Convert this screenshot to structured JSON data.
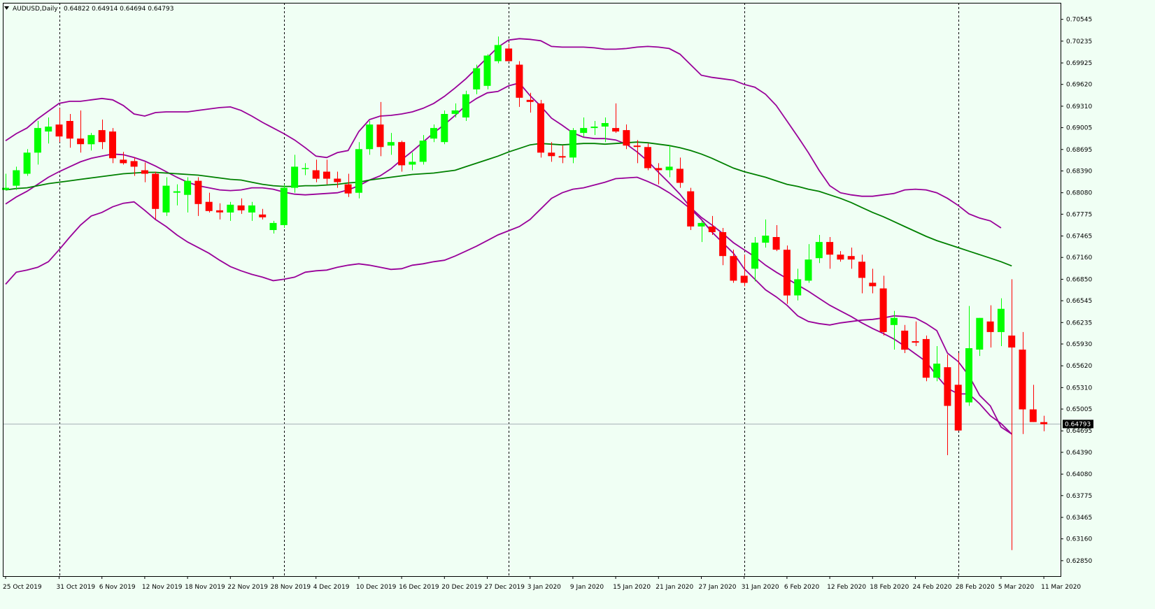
{
  "window": {
    "title": "AUDUSD,Daily",
    "ohlc": "0.64822 0.64914 0.64694 0.64793"
  },
  "colors": {
    "background": "#F0FFF4",
    "bull": "#00FF00",
    "bear": "#FF0000",
    "bands": "#990099",
    "ma": "#008000",
    "grid": "#000000"
  },
  "chart_data": {
    "type": "candlestick",
    "symbol": "AUDUSD",
    "timeframe": "Daily",
    "current_price": "0.64793",
    "ylim": [
      0.6263,
      0.7078
    ],
    "y_ticks": [
      "0.70545",
      "0.70235",
      "0.69925",
      "0.69620",
      "0.69310",
      "0.69005",
      "0.68695",
      "0.68390",
      "0.68080",
      "0.67775",
      "0.67465",
      "0.67160",
      "0.66850",
      "0.66545",
      "0.66235",
      "0.65930",
      "0.65620",
      "0.65310",
      "0.65005",
      "0.64695",
      "0.64390",
      "0.64080",
      "0.63775",
      "0.63465",
      "0.63160",
      "0.62850"
    ],
    "x_ticks": [
      {
        "label": "25 Oct 2019",
        "i": 0
      },
      {
        "label": "31 Oct 2019",
        "i": 5
      },
      {
        "label": "6 Nov 2019",
        "i": 9
      },
      {
        "label": "12 Nov 2019",
        "i": 13
      },
      {
        "label": "18 Nov 2019",
        "i": 17
      },
      {
        "label": "22 Nov 2019",
        "i": 21
      },
      {
        "label": "28 Nov 2019",
        "i": 25
      },
      {
        "label": "4 Dec 2019",
        "i": 29
      },
      {
        "label": "10 Dec 2019",
        "i": 33
      },
      {
        "label": "16 Dec 2019",
        "i": 37
      },
      {
        "label": "20 Dec 2019",
        "i": 41
      },
      {
        "label": "27 Dec 2019",
        "i": 45
      },
      {
        "label": "3 Jan 2020",
        "i": 49
      },
      {
        "label": "9 Jan 2020",
        "i": 53
      },
      {
        "label": "15 Jan 2020",
        "i": 57
      },
      {
        "label": "21 Jan 2020",
        "i": 61
      },
      {
        "label": "27 Jan 2020",
        "i": 65
      },
      {
        "label": "31 Jan 2020",
        "i": 69
      },
      {
        "label": "6 Feb 2020",
        "i": 73
      },
      {
        "label": "12 Feb 2020",
        "i": 77
      },
      {
        "label": "18 Feb 2020",
        "i": 81
      },
      {
        "label": "24 Feb 2020",
        "i": 85
      },
      {
        "label": "28 Feb 2020",
        "i": 89
      },
      {
        "label": "5 Mar 2020",
        "i": 93
      },
      {
        "label": "11 Mar 2020",
        "i": 97
      }
    ],
    "period_separators": [
      5,
      26,
      47,
      69,
      89
    ],
    "candles": [
      [
        0.6812,
        0.6835,
        0.6812,
        0.6815
      ],
      [
        0.6818,
        0.6845,
        0.6812,
        0.684
      ],
      [
        0.6835,
        0.687,
        0.6832,
        0.6865
      ],
      [
        0.6865,
        0.691,
        0.6848,
        0.69
      ],
      [
        0.6895,
        0.6915,
        0.6878,
        0.6902
      ],
      [
        0.6905,
        0.6928,
        0.688,
        0.6888
      ],
      [
        0.691,
        0.692,
        0.6872,
        0.6885
      ],
      [
        0.6885,
        0.6925,
        0.6865,
        0.6877
      ],
      [
        0.6877,
        0.6893,
        0.6868,
        0.689
      ],
      [
        0.6897,
        0.6912,
        0.687,
        0.688
      ],
      [
        0.6895,
        0.69,
        0.685,
        0.6857
      ],
      [
        0.6855,
        0.6866,
        0.6848,
        0.685
      ],
      [
        0.6853,
        0.6858,
        0.6832,
        0.6845
      ],
      [
        0.684,
        0.6851,
        0.6823,
        0.6835
      ],
      [
        0.6835,
        0.6838,
        0.677,
        0.6785
      ],
      [
        0.678,
        0.683,
        0.6775,
        0.6818
      ],
      [
        0.6808,
        0.682,
        0.679,
        0.681
      ],
      [
        0.6805,
        0.683,
        0.678,
        0.6825
      ],
      [
        0.6825,
        0.683,
        0.6775,
        0.6792
      ],
      [
        0.6795,
        0.6808,
        0.678,
        0.6782
      ],
      [
        0.6783,
        0.6793,
        0.677,
        0.678
      ],
      [
        0.678,
        0.6795,
        0.6768,
        0.6791
      ],
      [
        0.679,
        0.68,
        0.6778,
        0.6783
      ],
      [
        0.678,
        0.6795,
        0.6768,
        0.679
      ],
      [
        0.6777,
        0.6785,
        0.677,
        0.6773
      ],
      [
        0.6755,
        0.6768,
        0.675,
        0.6765
      ],
      [
        0.6762,
        0.682,
        0.6758,
        0.6815
      ],
      [
        0.6815,
        0.6862,
        0.6808,
        0.6845
      ],
      [
        0.6843,
        0.685,
        0.6833,
        0.6843
      ],
      [
        0.684,
        0.6855,
        0.6823,
        0.6828
      ],
      [
        0.6838,
        0.6855,
        0.682,
        0.6828
      ],
      [
        0.6828,
        0.6838,
        0.6815,
        0.6823
      ],
      [
        0.682,
        0.6835,
        0.6802,
        0.6807
      ],
      [
        0.6808,
        0.688,
        0.68,
        0.687
      ],
      [
        0.687,
        0.691,
        0.6862,
        0.6905
      ],
      [
        0.6905,
        0.6937,
        0.686,
        0.6873
      ],
      [
        0.6875,
        0.6893,
        0.6862,
        0.688
      ],
      [
        0.688,
        0.6882,
        0.6838,
        0.6847
      ],
      [
        0.6848,
        0.6865,
        0.684,
        0.6852
      ],
      [
        0.6852,
        0.689,
        0.6848,
        0.6882
      ],
      [
        0.6885,
        0.6905,
        0.688,
        0.69
      ],
      [
        0.688,
        0.6925,
        0.6877,
        0.692
      ],
      [
        0.692,
        0.6935,
        0.6915,
        0.6925
      ],
      [
        0.6915,
        0.6953,
        0.691,
        0.6948
      ],
      [
        0.6955,
        0.699,
        0.6948,
        0.6985
      ],
      [
        0.696,
        0.7005,
        0.6955,
        0.7003
      ],
      [
        0.6995,
        0.703,
        0.6992,
        0.7018
      ],
      [
        0.7013,
        0.702,
        0.6995,
        0.6995
      ],
      [
        0.699,
        0.6995,
        0.693,
        0.6943
      ],
      [
        0.694,
        0.695,
        0.6922,
        0.6937
      ],
      [
        0.6935,
        0.694,
        0.6858,
        0.6865
      ],
      [
        0.6865,
        0.688,
        0.6852,
        0.686
      ],
      [
        0.686,
        0.6875,
        0.685,
        0.6858
      ],
      [
        0.6858,
        0.69,
        0.685,
        0.6897
      ],
      [
        0.6893,
        0.6915,
        0.6888,
        0.69
      ],
      [
        0.69,
        0.691,
        0.689,
        0.6902
      ],
      [
        0.6902,
        0.6915,
        0.688,
        0.6907
      ],
      [
        0.69,
        0.6935,
        0.6893,
        0.6895
      ],
      [
        0.6897,
        0.6905,
        0.687,
        0.6875
      ],
      [
        0.6875,
        0.6883,
        0.685,
        0.6873
      ],
      [
        0.6873,
        0.6878,
        0.684,
        0.6843
      ],
      [
        0.6843,
        0.685,
        0.682,
        0.684
      ],
      [
        0.684,
        0.6875,
        0.683,
        0.6845
      ],
      [
        0.6842,
        0.6858,
        0.6815,
        0.6822
      ],
      [
        0.681,
        0.6815,
        0.6755,
        0.676
      ],
      [
        0.676,
        0.6768,
        0.6738,
        0.6765
      ],
      [
        0.676,
        0.6775,
        0.6748,
        0.6752
      ],
      [
        0.6752,
        0.6758,
        0.6705,
        0.6718
      ],
      [
        0.6718,
        0.6727,
        0.668,
        0.6683
      ],
      [
        0.669,
        0.672,
        0.6675,
        0.668
      ],
      [
        0.67,
        0.6745,
        0.6682,
        0.6737
      ],
      [
        0.6737,
        0.677,
        0.673,
        0.6747
      ],
      [
        0.6745,
        0.6762,
        0.6725,
        0.6727
      ],
      [
        0.6727,
        0.6733,
        0.665,
        0.6662
      ],
      [
        0.6662,
        0.67,
        0.6655,
        0.6685
      ],
      [
        0.6683,
        0.6735,
        0.668,
        0.6713
      ],
      [
        0.6715,
        0.6748,
        0.6708,
        0.6738
      ],
      [
        0.6738,
        0.6745,
        0.67,
        0.672
      ],
      [
        0.672,
        0.6725,
        0.671,
        0.6713
      ],
      [
        0.6718,
        0.673,
        0.67,
        0.6713
      ],
      [
        0.671,
        0.672,
        0.6665,
        0.6687
      ],
      [
        0.668,
        0.67,
        0.6665,
        0.6675
      ],
      [
        0.6672,
        0.669,
        0.6605,
        0.661
      ],
      [
        0.662,
        0.664,
        0.6585,
        0.663
      ],
      [
        0.6612,
        0.662,
        0.658,
        0.6585
      ],
      [
        0.6597,
        0.6625,
        0.659,
        0.6595
      ],
      [
        0.66,
        0.6605,
        0.654,
        0.6545
      ],
      [
        0.6545,
        0.659,
        0.654,
        0.6565
      ],
      [
        0.656,
        0.6578,
        0.6435,
        0.6505
      ],
      [
        0.6535,
        0.658,
        0.647,
        0.647
      ],
      [
        0.651,
        0.6647,
        0.6505,
        0.6587
      ],
      [
        0.6585,
        0.663,
        0.6576,
        0.663
      ],
      [
        0.6625,
        0.6648,
        0.6588,
        0.661
      ],
      [
        0.661,
        0.6658,
        0.659,
        0.6643
      ],
      [
        0.6605,
        0.6685,
        0.63,
        0.6588
      ],
      [
        0.6585,
        0.661,
        0.6465,
        0.65
      ],
      [
        0.65,
        0.6535,
        0.6482,
        0.6482
      ],
      [
        0.6482,
        0.6491,
        0.6469,
        0.6479
      ]
    ],
    "series": [
      {
        "kind": "upper-band",
        "values": [
          0.6882,
          0.6892,
          0.69,
          0.6913,
          0.6924,
          0.6935,
          0.6938,
          0.6938,
          0.694,
          0.6942,
          0.694,
          0.6932,
          0.692,
          0.6917,
          0.6922,
          0.6923,
          0.6923,
          0.6923,
          0.6925,
          0.6927,
          0.6929,
          0.693,
          0.6925,
          0.6917,
          0.6908,
          0.69,
          0.6892,
          0.6883,
          0.6872,
          0.686,
          0.6858,
          0.6865,
          0.6868,
          0.6895,
          0.6912,
          0.6917,
          0.6918,
          0.692,
          0.6923,
          0.6928,
          0.6935,
          0.6945,
          0.6957,
          0.697,
          0.6985,
          0.7,
          0.7015,
          0.7025,
          0.7027,
          0.7026,
          0.7024,
          0.7016,
          0.7015,
          0.7015,
          0.7015,
          0.7014,
          0.7012,
          0.7012,
          0.7013,
          0.7015,
          0.7016,
          0.7015,
          0.7013,
          0.7005,
          0.699,
          0.6975,
          0.6972,
          0.697,
          0.6968,
          0.6962,
          0.6958,
          0.6948,
          0.6932,
          0.691,
          0.6888,
          0.6865,
          0.684,
          0.6818,
          0.6808,
          0.6805,
          0.6803,
          0.6803,
          0.6805,
          0.6807,
          0.6812,
          0.6813,
          0.6812,
          0.6808,
          0.68,
          0.679,
          0.6778,
          0.6772,
          0.6768,
          0.6758
        ]
      },
      {
        "kind": "middle-band",
        "values": [
          0.6792,
          0.6802,
          0.681,
          0.682,
          0.683,
          0.6838,
          0.6845,
          0.6852,
          0.6857,
          0.686,
          0.6863,
          0.6862,
          0.6858,
          0.6853,
          0.6846,
          0.6838,
          0.683,
          0.6823,
          0.6818,
          0.6815,
          0.6812,
          0.6811,
          0.6812,
          0.6815,
          0.6815,
          0.6813,
          0.6809,
          0.6806,
          0.6805,
          0.6806,
          0.6807,
          0.6808,
          0.6812,
          0.6818,
          0.6826,
          0.6832,
          0.6842,
          0.6855,
          0.6867,
          0.688,
          0.6893,
          0.6905,
          0.6918,
          0.6932,
          0.6942,
          0.695,
          0.6952,
          0.696,
          0.6964,
          0.6946,
          0.6931,
          0.6914,
          0.6904,
          0.6893,
          0.6887,
          0.6885,
          0.6885,
          0.6883,
          0.6877,
          0.6866,
          0.6853,
          0.6837,
          0.6822,
          0.6806,
          0.6787,
          0.6773,
          0.6762,
          0.675,
          0.6737,
          0.6727,
          0.6717,
          0.6705,
          0.6695,
          0.6686,
          0.6677,
          0.6668,
          0.6658,
          0.6648,
          0.664,
          0.6632,
          0.6623,
          0.6615,
          0.6608,
          0.66,
          0.659,
          0.6579,
          0.6568,
          0.6548,
          0.653,
          0.6522,
          0.6522,
          0.6508,
          0.6491,
          0.648,
          0.6465
        ]
      },
      {
        "kind": "lower-band",
        "values": [
          0.6678,
          0.6695,
          0.6698,
          0.6702,
          0.671,
          0.6727,
          0.6745,
          0.6762,
          0.6775,
          0.678,
          0.6788,
          0.6793,
          0.6795,
          0.6783,
          0.677,
          0.676,
          0.6748,
          0.6738,
          0.673,
          0.6722,
          0.6712,
          0.6703,
          0.6697,
          0.6692,
          0.6688,
          0.6683,
          0.6685,
          0.6688,
          0.6695,
          0.6697,
          0.6698,
          0.6702,
          0.6705,
          0.6707,
          0.6705,
          0.6702,
          0.6699,
          0.67,
          0.6705,
          0.6707,
          0.671,
          0.6712,
          0.6718,
          0.6725,
          0.6732,
          0.674,
          0.6748,
          0.6754,
          0.676,
          0.677,
          0.6785,
          0.68,
          0.6808,
          0.6813,
          0.6815,
          0.6819,
          0.6823,
          0.6828,
          0.6829,
          0.683,
          0.6824,
          0.6817,
          0.6808,
          0.6797,
          0.6785,
          0.677,
          0.6752,
          0.6737,
          0.6722,
          0.67,
          0.6685,
          0.667,
          0.666,
          0.6648,
          0.6633,
          0.6625,
          0.6622,
          0.662,
          0.6623,
          0.6625,
          0.6627,
          0.6628,
          0.663,
          0.6633,
          0.6632,
          0.663,
          0.6622,
          0.6612,
          0.658,
          0.6568,
          0.6548,
          0.652,
          0.6505,
          0.6475,
          0.6465
        ]
      },
      {
        "kind": "moving-average",
        "values": [
          0.6812,
          0.6814,
          0.6815,
          0.6818,
          0.6821,
          0.6823,
          0.6825,
          0.6827,
          0.6829,
          0.6831,
          0.6833,
          0.6835,
          0.6836,
          0.6837,
          0.6837,
          0.6836,
          0.6835,
          0.6834,
          0.6833,
          0.6831,
          0.6829,
          0.6827,
          0.6826,
          0.6823,
          0.682,
          0.6818,
          0.6817,
          0.6817,
          0.6818,
          0.6818,
          0.6819,
          0.682,
          0.6822,
          0.6823,
          0.6826,
          0.6828,
          0.683,
          0.6832,
          0.6834,
          0.6835,
          0.6836,
          0.6838,
          0.684,
          0.6845,
          0.685,
          0.6855,
          0.686,
          0.6866,
          0.6871,
          0.6876,
          0.6878,
          0.6877,
          0.6876,
          0.6877,
          0.6878,
          0.6878,
          0.6877,
          0.6878,
          0.6879,
          0.688,
          0.6879,
          0.6877,
          0.6875,
          0.6872,
          0.6868,
          0.6863,
          0.6857,
          0.685,
          0.6843,
          0.6838,
          0.6834,
          0.683,
          0.6825,
          0.682,
          0.6817,
          0.6813,
          0.681,
          0.6805,
          0.68,
          0.6794,
          0.6787,
          0.678,
          0.6774,
          0.6767,
          0.676,
          0.6753,
          0.6746,
          0.674,
          0.6735,
          0.673,
          0.6725,
          0.672,
          0.6715,
          0.671,
          0.6704
        ]
      }
    ]
  }
}
